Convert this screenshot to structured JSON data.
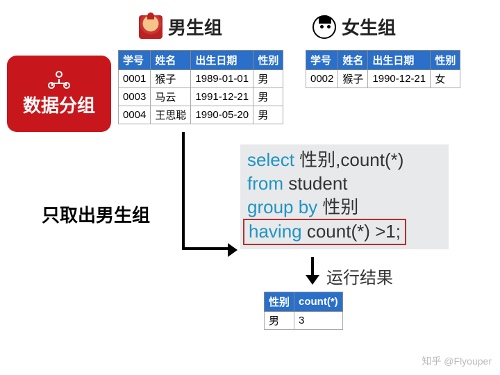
{
  "headings": {
    "male": "男生组",
    "female": "女生组"
  },
  "red_box": "数据分组",
  "columns": {
    "id": "学号",
    "name": "姓名",
    "birth": "出生日期",
    "gender": "性别"
  },
  "male_rows": [
    {
      "id": "0001",
      "name": "猴子",
      "birth": "1989-01-01",
      "gender": "男"
    },
    {
      "id": "0003",
      "name": "马云",
      "birth": "1991-12-21",
      "gender": "男"
    },
    {
      "id": "0004",
      "name": "王思聪",
      "birth": "1990-05-20",
      "gender": "男"
    }
  ],
  "female_rows": [
    {
      "id": "0002",
      "name": "猴子",
      "birth": "1990-12-21",
      "gender": "女"
    }
  ],
  "sub_heading": "只取出男生组",
  "sql": {
    "kw_select": "select",
    "sel_cols": " 性别,count(*)",
    "kw_from": "from",
    "from_tbl": " student",
    "kw_group": "group by",
    "group_col": " 性别",
    "kw_having": "having",
    "having_cond": " count(*) >1;"
  },
  "result_label": "运行结果",
  "result_cols": {
    "gender": "性别",
    "count": "count(*)"
  },
  "result_rows": [
    {
      "gender": "男",
      "count": "3"
    }
  ],
  "watermark": "知乎 @Flyouper"
}
